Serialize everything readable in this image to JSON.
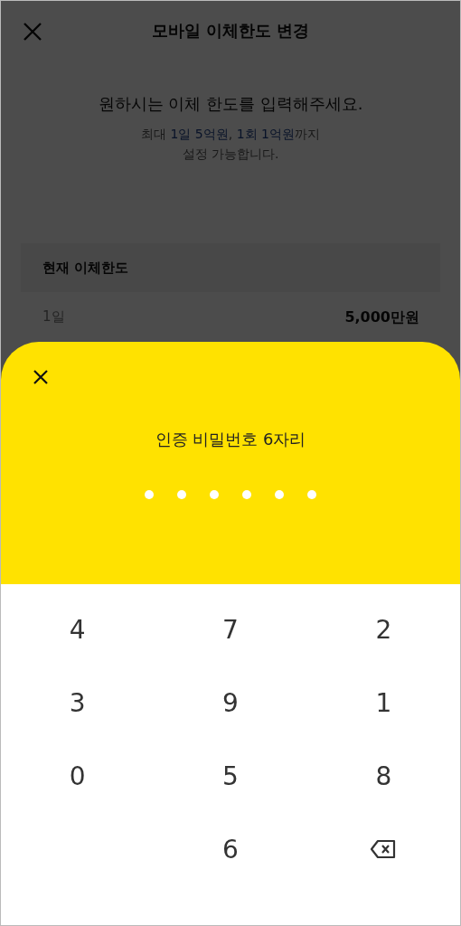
{
  "header": {
    "title": "모바일 이체한도 변경"
  },
  "prompt": "원하시는 이체 한도를 입력해주세요.",
  "note_line1": [
    {
      "text": "최대 ",
      "highlight": false
    },
    {
      "text": "1일 5억원",
      "highlight": true
    },
    {
      "text": ", ",
      "highlight": false
    },
    {
      "text": "1회 1억원",
      "highlight": true
    },
    {
      "text": "까지",
      "highlight": false
    }
  ],
  "note_line2": "설정 가능합니다.",
  "current_limit": {
    "title": "현재 이체한도",
    "rows": [
      {
        "label": "1일",
        "value": "5,000만원"
      }
    ]
  },
  "pin_sheet": {
    "title": "인증 비밀번호 6자리",
    "dots": [
      {
        "filled": false
      },
      {
        "filled": false
      },
      {
        "filled": false
      },
      {
        "filled": false
      },
      {
        "filled": false
      },
      {
        "filled": false
      }
    ],
    "keys": [
      {
        "kind": "digit",
        "label": "4"
      },
      {
        "kind": "digit",
        "label": "7"
      },
      {
        "kind": "digit",
        "label": "2"
      },
      {
        "kind": "digit",
        "label": "3"
      },
      {
        "kind": "digit",
        "label": "9"
      },
      {
        "kind": "digit",
        "label": "1"
      },
      {
        "kind": "digit",
        "label": "0"
      },
      {
        "kind": "digit",
        "label": "5"
      },
      {
        "kind": "digit",
        "label": "8"
      },
      {
        "kind": "empty"
      },
      {
        "kind": "digit",
        "label": "6"
      },
      {
        "kind": "backspace"
      }
    ]
  }
}
